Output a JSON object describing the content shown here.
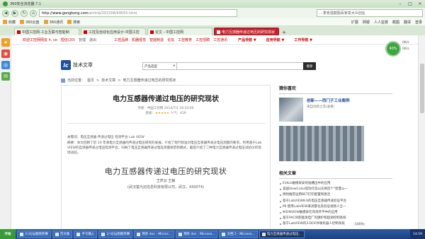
{
  "window": {
    "title": "360安全浏览器 7.1"
  },
  "address": {
    "host": "http://www.gongkong.com",
    "path": "/article/201508/49555.html",
    "search_placeholder": "...李克强鼓励百家发大众创业"
  },
  "favbar": {
    "items": [
      "收藏",
      "360云盘",
      "360通讯",
      "搜索"
    ],
    "right": [
      "扩展",
      "网银",
      "人人监督",
      "截图",
      "翻译",
      "登录",
      "登录"
    ]
  },
  "tabs": [
    {
      "label": "中国工控网-工业互联与智能制"
    },
    {
      "label": "工控及自动化应用设计-中国工控"
    },
    {
      "label": "论文 - 中国工控网"
    },
    {
      "label": "电力互感器传递过电压的研究现状",
      "active": true
    }
  ],
  "sidebar": {
    "icons": [
      "star-icon",
      "weibo-icon",
      "compass-icon",
      "message-icon"
    ]
  },
  "site": {
    "top_left": "欢迎工控网网友 h. ce",
    "top_user": "短信(20)",
    "top_links": [
      "管理",
      "退出"
    ],
    "nav_links": [
      "工控品牌",
      "机器视觉",
      "智能制造",
      "论坛",
      "工控教育",
      "工控招聘",
      "工控通讯"
    ],
    "dropdowns": [
      "产品导航 ▼",
      "应用导航 ▼",
      "工作导航 ▼"
    ],
    "gauge": "40%",
    "speed": [
      "0K/s",
      "0K/s"
    ],
    "logo": "技术文章",
    "search_select": "产品选型",
    "search_button": "搜索",
    "breadcrumb": [
      "当前位置：",
      "首页",
      ">",
      "技术文章",
      ">",
      "电力互感器传递过电压的研究现状"
    ]
  },
  "article": {
    "title": "电力互感器传递过电压的研究现状",
    "source": "作者：中国工控网  2014/7/1 16:34:00",
    "rating_label": "星级：",
    "stars": "★★★★★",
    "views": "人气：419",
    "keywords": "关键词：电压互感器 传递过电压 检测平台 Lab VIEW",
    "abstract": "摘要：本文回顾了近 10 年来电力互感器的传递过电压研究的发展。介绍了现行标准对电压互感器传递过电压测量的要求。利用基于Lab VIEW的互感器传递过电压检测平台，归纳了电压互感器传递过电压测量规范和模式，最后介绍了二种电力互感器传递过电压试验仪的现场试验。",
    "big_title": "电力互感器传递过电压的研究现状",
    "authors": "王彦云  王巍",
    "affiliation": "(武汉楚为迈信息科技有限公司，武汉，430074)"
  },
  "right": {
    "rec_heading": "猜你喜欢",
    "rec_title": "创新——西门子工业案例",
    "rec_sub": "来自创新之花(查看)",
    "related_heading": "相关文章",
    "related": [
      "EV&in触摸屏安装插槽出中的应用",
      "美国ViewColor成功打造山东那首个\"智慧公一",
      "特别推荐运用BET打印配置和激活",
      "基于LabVIEW8.6的电压互感器传递验证平台",
      "MI 使用LabVIEW来测量化及验证视频人全一",
      "WEINVIEW触摸屏在风场开平中的应用",
      "基于PAC的职能发电厂的健护和超调控制系统",
      "基于LabVIEW的3-DOF并联机器人控制系统"
    ]
  },
  "pagebar": [
    "100%"
  ],
  "taskbar": {
    "start": "开始",
    "tasks": [
      {
        "label": "3:\\论坛图图参赛"
      },
      {
        "label": "百文集"
      },
      {
        "label": "手写输入"
      },
      {
        "label": "3:\\论坛图图参赛"
      },
      {
        "label": "预旁 doc - Micros..."
      },
      {
        "label": "预旁 doc - Microso..."
      },
      {
        "label": "文档 2 - Microso..."
      },
      {
        "label": "电力互感器传递过电压..."
      }
    ],
    "time": "14:59"
  }
}
